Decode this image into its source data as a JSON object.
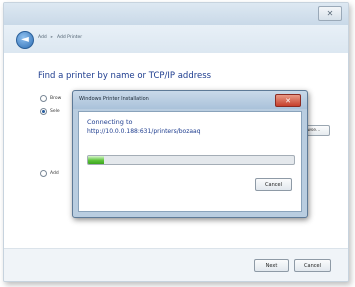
{
  "window": {
    "close_glyph": "✕"
  },
  "nav": {
    "back_glyph": "◄",
    "path_items": [
      "Add",
      "Add Printer"
    ]
  },
  "main": {
    "heading": "Find a printer by name or TCP/IP address",
    "options": [
      {
        "label": "Brow",
        "type": "radio",
        "selected": false
      },
      {
        "label": "Sele",
        "type": "radio",
        "selected": true
      },
      {
        "label": "Add",
        "type": "radio",
        "selected": false
      }
    ],
    "browse_label": "Browse..."
  },
  "footer": {
    "next_label": "Next",
    "cancel_label": "Cancel"
  },
  "dialog": {
    "title": "Windows Printer Installation",
    "close_glyph": "✕",
    "message": "Connecting to",
    "url": "http://10.0.0.188:631/printers/bozaaq",
    "progress_percent": 8,
    "cancel_label": "Cancel"
  },
  "colors": {
    "heading_blue": "#1e3d8f",
    "progress_green": "#5cc33a",
    "close_red": "#c6402c"
  }
}
